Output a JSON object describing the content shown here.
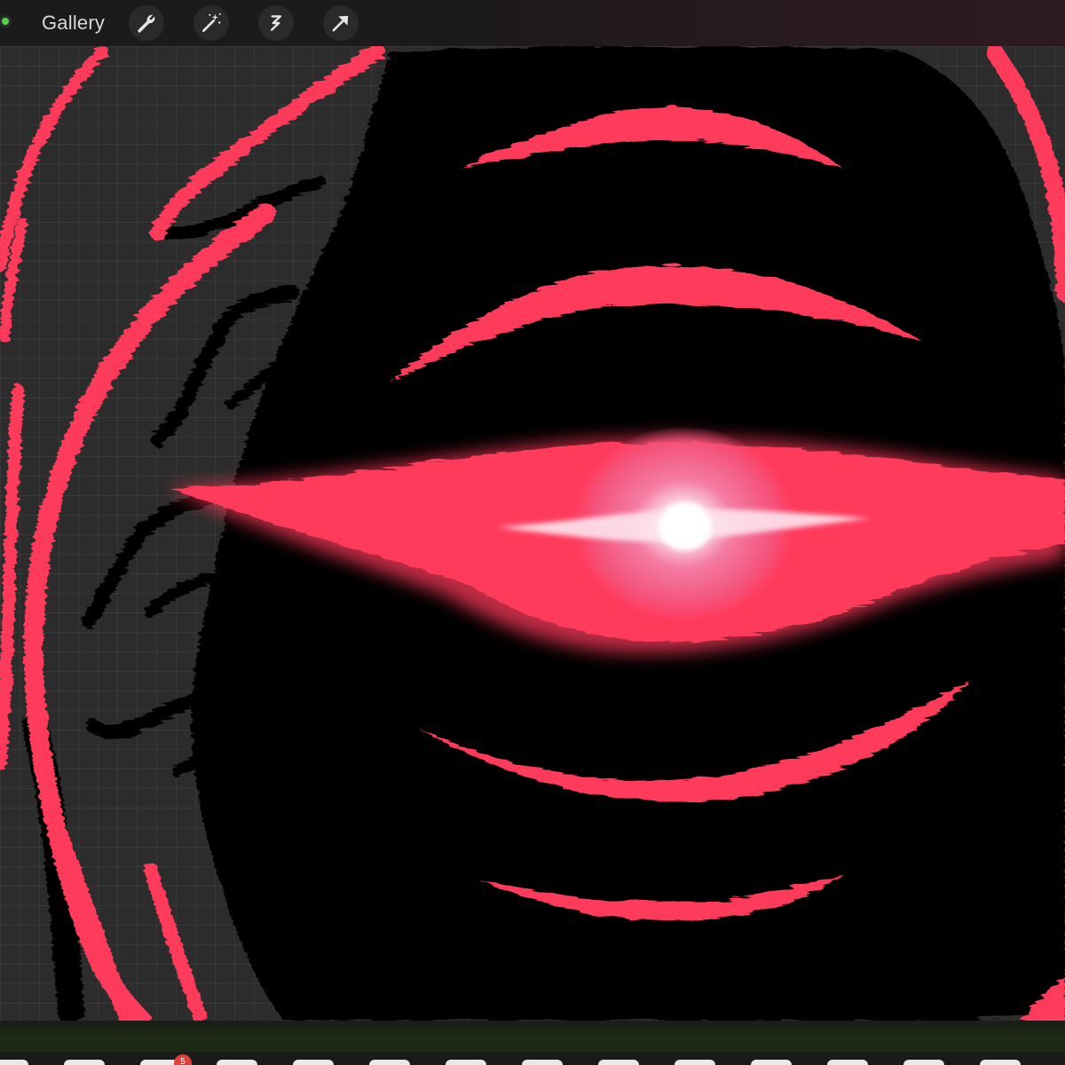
{
  "toolbar": {
    "gallery_label": "Gallery",
    "tools": [
      {
        "name": "actions",
        "icon": "wrench-icon"
      },
      {
        "name": "adjustments",
        "icon": "magic-wand-icon"
      },
      {
        "name": "selection",
        "icon": "selection-s-icon"
      },
      {
        "name": "transform",
        "icon": "arrow-cursor-icon"
      }
    ]
  },
  "dock": {
    "badge_count": "5"
  },
  "colors": {
    "accent_red": "#ff3a5c",
    "glow_pink": "#f56a96",
    "ink": "#000000",
    "canvas_bg": "#2c2c2c",
    "status_green": "#58d04a",
    "badge_red": "#e0403c"
  }
}
